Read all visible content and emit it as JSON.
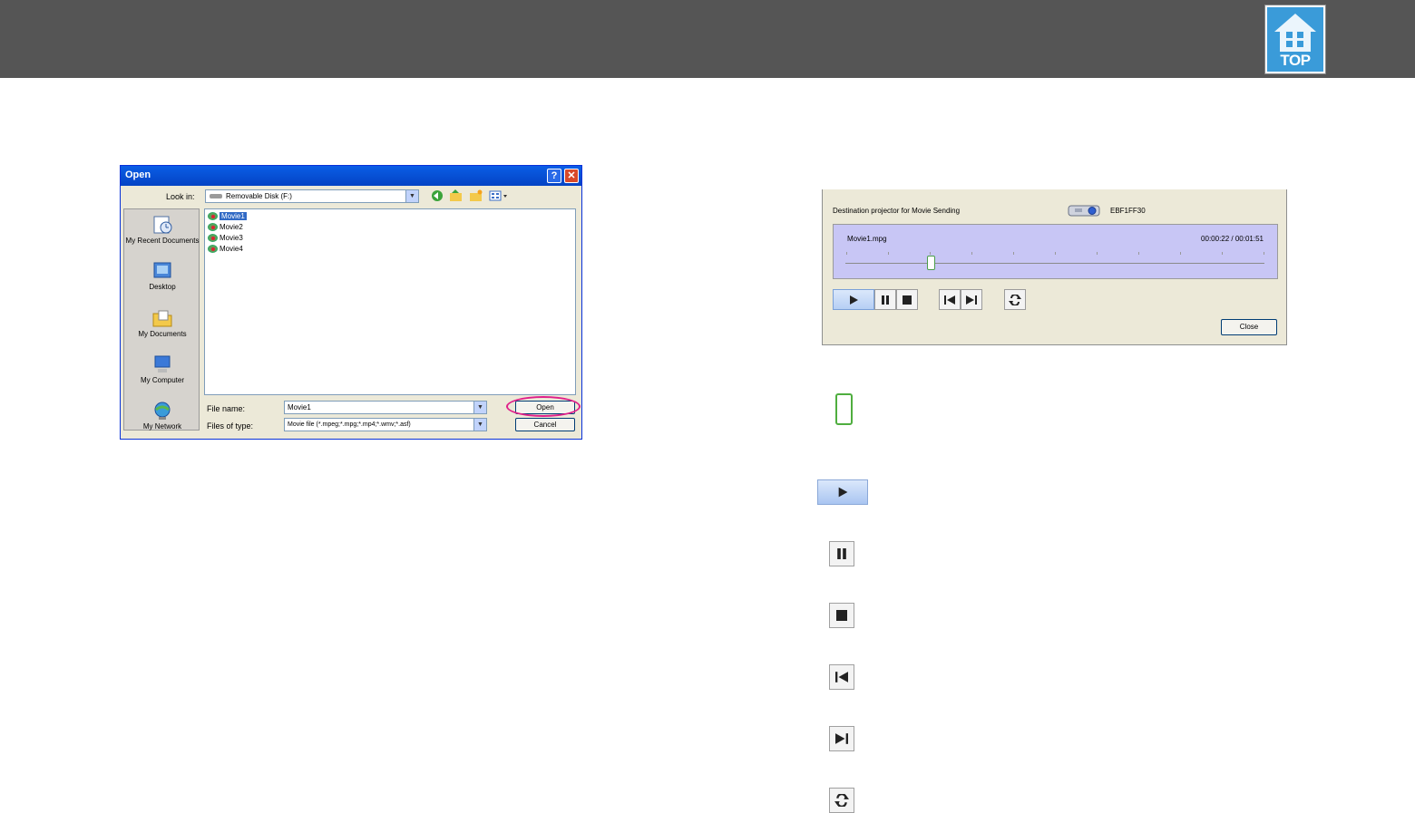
{
  "header": {
    "logo": "TOP",
    "colors": {
      "bar": "#555555",
      "logo": "#3a9bd9"
    }
  },
  "open_dialog": {
    "title": "Open",
    "help_label": "?",
    "close_label": "✕",
    "look_in_label": "Look in:",
    "look_in_value": "Removable Disk (F:)",
    "places": [
      "My Recent Documents",
      "Desktop",
      "My Documents",
      "My Computer",
      "My Network"
    ],
    "files": [
      "Movie1",
      "Movie2",
      "Movie3",
      "Movie4"
    ],
    "selected_file": "Movie1",
    "file_name_label": "File name:",
    "file_name_value": "Movie1",
    "file_type_label": "Files of type:",
    "file_type_value": "Movie file (*.mpeg;*.mpg;*.mp4;*.wmv;*.asf)",
    "open_button": "Open",
    "cancel_button": "Cancel"
  },
  "movie_panel": {
    "dest_label": "Destination projector for Movie Sending",
    "projector_name": "EBF1FF30",
    "movie_name": "Movie1.mpg",
    "time": "00:00:22 / 00:01:51",
    "close_button": "Close",
    "controls": [
      "play-icon",
      "pause-icon",
      "stop-icon",
      "previous-icon",
      "next-icon",
      "repeat-icon"
    ],
    "accent": "#c8c6f5"
  },
  "legend_icons": [
    "slider-thumb",
    "play-icon",
    "pause-icon",
    "stop-icon",
    "previous-icon",
    "next-icon",
    "repeat-icon"
  ]
}
